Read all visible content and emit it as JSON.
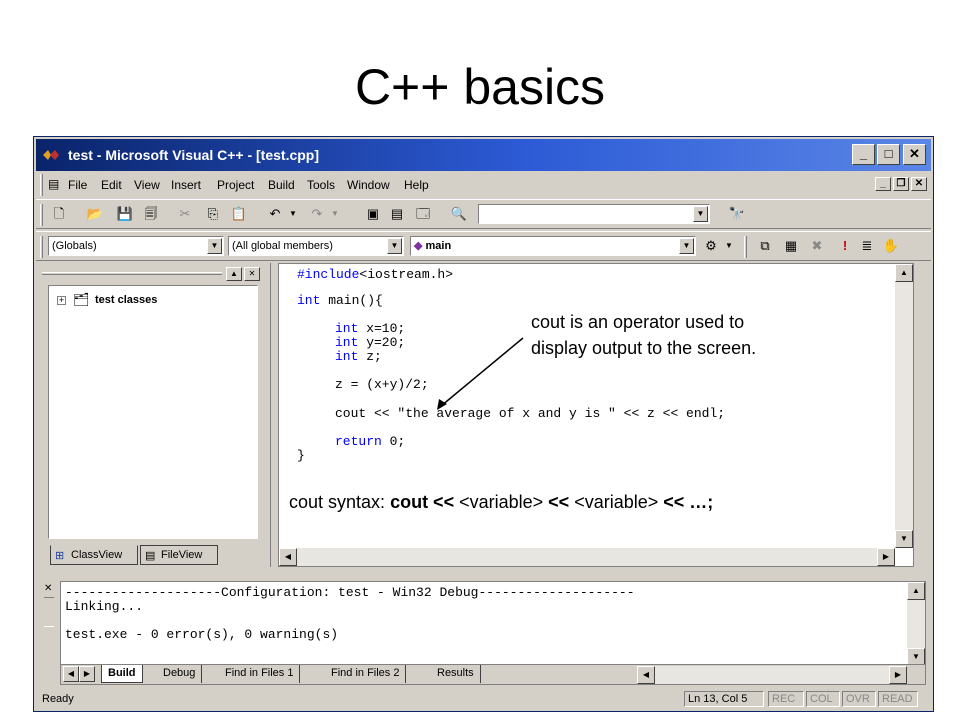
{
  "slide_title": "C++ basics",
  "window": {
    "title": "test - Microsoft Visual C++ - [test.cpp]"
  },
  "menu": [
    "File",
    "Edit",
    "View",
    "Insert",
    "Project",
    "Build",
    "Tools",
    "Window",
    "Help"
  ],
  "wizard_bar": {
    "scope": "(Globals)",
    "members": "(All global members)",
    "function": "main"
  },
  "workspace": {
    "tree_root": "test classes",
    "tabs": [
      "ClassView",
      "FileView"
    ]
  },
  "code_lines": [
    {
      "kw": "#include",
      "rest": "<iostream.h>"
    },
    {
      "kw": "int",
      "rest": " main(){"
    },
    {
      "kw": "int",
      "rest": " x=10;"
    },
    {
      "kw": "int",
      "rest": " y=20;"
    },
    {
      "kw": "int",
      "rest": " z;"
    },
    {
      "kw": "",
      "rest": "z = (x+y)/2;"
    },
    {
      "kw": "",
      "rest": "cout << \"the average of x and y is \" << z << endl;"
    },
    {
      "kw": "return",
      "rest": " 0;"
    },
    {
      "kw": "",
      "rest": "}"
    }
  ],
  "annotations": {
    "cout_note_line1": "cout is an operator used to",
    "cout_note_line2": "display output to the screen.",
    "syntax_prefix": "cout syntax: ",
    "syntax_bold1": "cout <<",
    "syntax_var1": " <variable> ",
    "syntax_bold2": "<<",
    "syntax_var2": " <variable> ",
    "syntax_bold3": "<< …;"
  },
  "output": {
    "lines": [
      "--------------------Configuration: test - Win32 Debug--------------------",
      "Linking...",
      "",
      "test.exe - 0 error(s), 0 warning(s)"
    ],
    "tabs": [
      "Build",
      "Debug",
      "Find in Files 1",
      "Find in Files 2",
      "Results"
    ]
  },
  "status": {
    "text": "Ready",
    "position": "Ln 13, Col 5",
    "indicators": [
      "REC",
      "COL",
      "OVR",
      "READ"
    ]
  }
}
